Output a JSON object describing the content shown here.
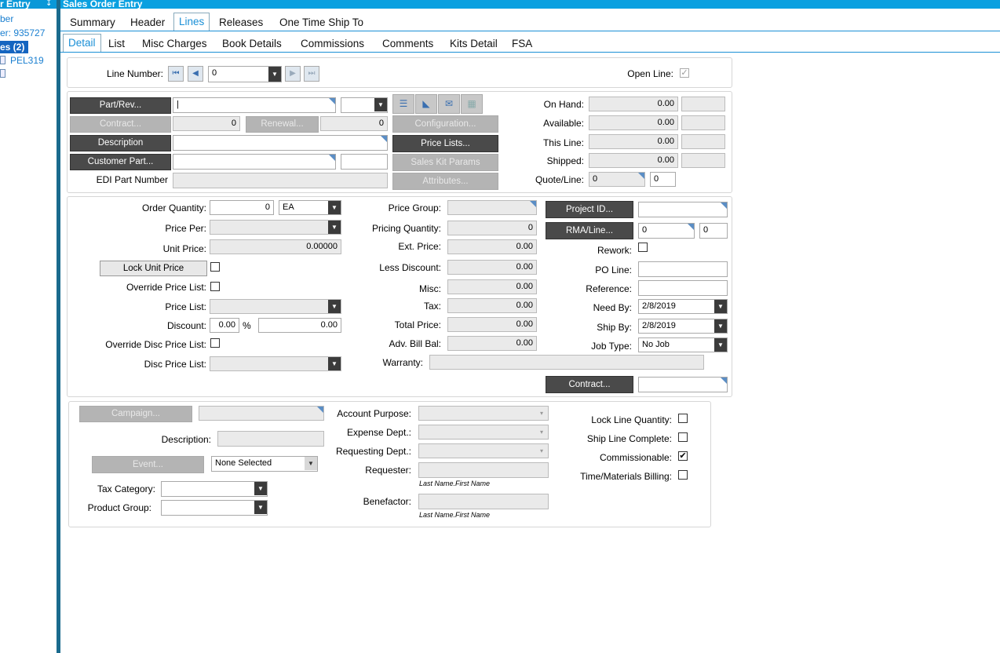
{
  "left_pane": {
    "title": "r Entry",
    "pin": "↧",
    "item1": "ber",
    "item2": "er: 935727",
    "selected": "es (2)",
    "item4": "PEL319"
  },
  "window_title": "Sales Order Entry",
  "tabs_top": [
    "Summary",
    "Header",
    "Lines",
    "Releases",
    "One Time Ship To"
  ],
  "tabs_sub": [
    "Detail",
    "List",
    "Misc Charges",
    "Book Details",
    "Commissions",
    "Comments",
    "Kits Detail",
    "FSA"
  ],
  "line_nav": {
    "label": "Line Number:",
    "value": "0",
    "open_line_label": "Open Line:",
    "open_line_checked": "✓"
  },
  "part": {
    "part_rev_btn": "Part/Rev...",
    "part_value": "|",
    "contract_btn": "Contract...",
    "contract_value": "0",
    "renewal_btn": "Renewal...",
    "renewal_value": "0",
    "description_btn": "Description",
    "customer_part_btn": "Customer Part...",
    "edi_label": "EDI Part Number",
    "configuration_btn": "Configuration...",
    "price_lists_btn": "Price Lists...",
    "sales_kit_btn": "Sales Kit Params",
    "attributes_btn": "Attributes..."
  },
  "stock": {
    "on_hand_label": "On Hand:",
    "on_hand": "0.00",
    "available_label": "Available:",
    "available": "0.00",
    "this_line_label": "This Line:",
    "this_line": "0.00",
    "shipped_label": "Shipped:",
    "shipped": "0.00",
    "quote_line_label": "Quote/Line:",
    "quote": "0",
    "quote_line": "0"
  },
  "pricing": {
    "order_qty_label": "Order Quantity:",
    "order_qty": "0",
    "uom": "EA",
    "price_per_label": "Price Per:",
    "unit_price_label": "Unit Price:",
    "unit_price": "0.00000",
    "lock_unit_price_btn": "Lock Unit Price",
    "override_price_list_label": "Override Price List:",
    "price_list_label": "Price List:",
    "discount_label": "Discount:",
    "discount_pct": "0.00",
    "pct_sign": "%",
    "discount_amt": "0.00",
    "override_disc_label": "Override Disc Price List:",
    "disc_price_list_label": "Disc Price List:"
  },
  "totals": {
    "price_group_label": "Price Group:",
    "pricing_qty_label": "Pricing Quantity:",
    "pricing_qty": "0",
    "ext_price_label": "Ext. Price:",
    "ext_price": "0.00",
    "less_discount_label": "Less Discount:",
    "less_discount": "0.00",
    "misc_label": "Misc:",
    "misc": "0.00",
    "tax_label": "Tax:",
    "tax": "0.00",
    "total_price_label": "Total Price:",
    "total_price": "0.00",
    "adv_bill_label": "Adv. Bill Bal:",
    "adv_bill": "0.00",
    "warranty_label": "Warranty:"
  },
  "project": {
    "project_id_btn": "Project ID...",
    "rma_btn": "RMA/Line...",
    "rma": "0",
    "rma_line": "0",
    "rework_label": "Rework:",
    "po_line_label": "PO Line:",
    "reference_label": "Reference:",
    "need_by_label": "Need By:",
    "need_by": "2/8/2019",
    "ship_by_label": "Ship By:",
    "ship_by": "2/8/2019",
    "job_type_label": "Job Type:",
    "job_type": "No Job",
    "contract_btn": "Contract..."
  },
  "campaign": {
    "campaign_btn": "Campaign...",
    "description_label": "Description:",
    "event_btn": "Event...",
    "event_value": "None Selected",
    "tax_category_label": "Tax Category:",
    "product_group_label": "Product Group:",
    "account_purpose_label": "Account Purpose:",
    "expense_dept_label": "Expense Dept.:",
    "requesting_dept_label": "Requesting Dept.:",
    "requester_label": "Requester:",
    "requester_hint": "Last Name.First Name",
    "benefactor_label": "Benefactor:",
    "benefactor_hint": "Last Name.First Name",
    "lock_line_qty_label": "Lock Line Quantity:",
    "ship_line_complete_label": "Ship Line Complete:",
    "commissionable_label": "Commissionable:",
    "commissionable_checked": "✔",
    "tm_billing_label": "Time/Materials Billing:"
  },
  "icons": [
    "pin-icon",
    "document-icon",
    "first-record-icon",
    "previous-record-icon",
    "next-record-icon",
    "last-record-icon",
    "dropdown-arrow-icon",
    "checkmark-icon"
  ]
}
